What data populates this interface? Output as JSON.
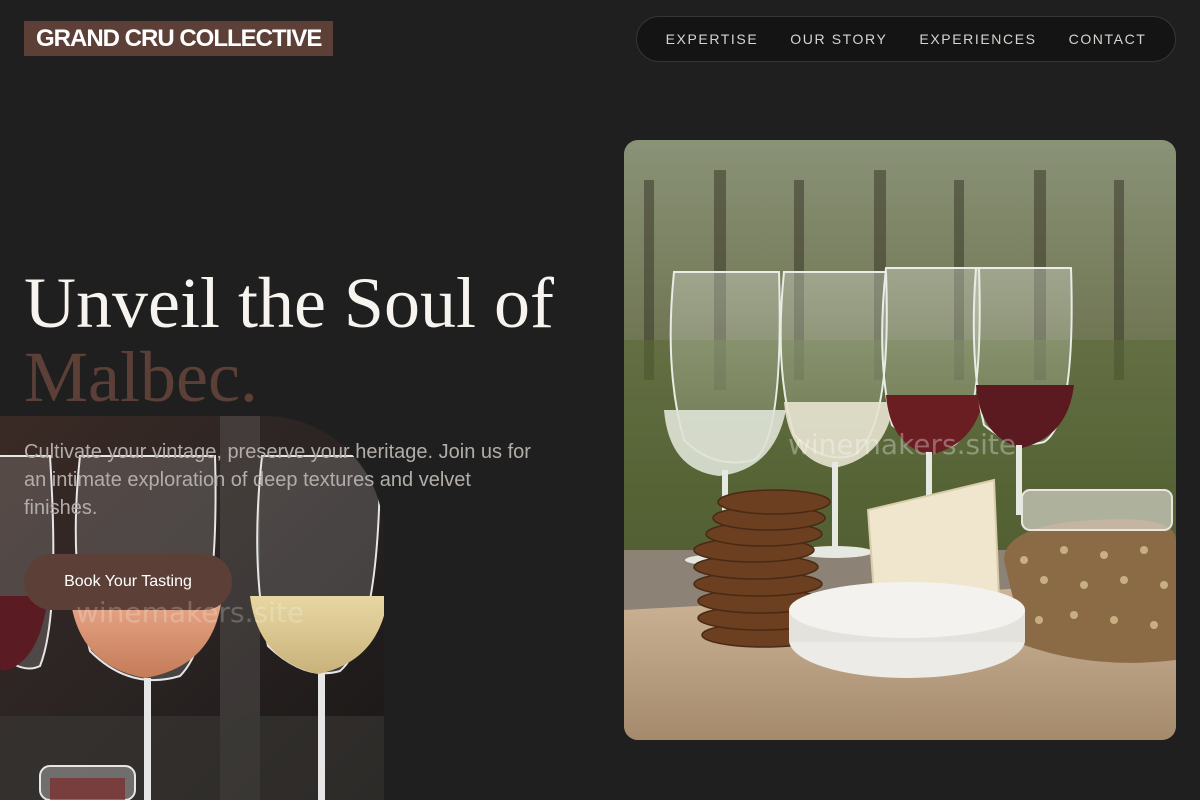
{
  "brand": {
    "logo_text": "GRAND CRU COLLECTIVE"
  },
  "nav": {
    "items": [
      {
        "label": "EXPERTISE"
      },
      {
        "label": "OUR STORY"
      },
      {
        "label": "EXPERIENCES"
      },
      {
        "label": "CONTACT"
      }
    ]
  },
  "hero": {
    "headline_line1": "Unveil the Soul of",
    "headline_accent": "Malbec.",
    "subtext": "Cultivate your vintage, preserve your heritage. Join us for an intimate exploration of deep textures and velvet finishes.",
    "cta_label": "Book Your Tasting",
    "watermark": "winemakers.site"
  },
  "images": {
    "hero_photo": "vineyard wine glasses with cheese and crackers board",
    "side_photo": "glasses of rosé and white wine"
  },
  "colors": {
    "background": "#1f1f1f",
    "accent": "#5c4038",
    "text_primary": "#f7f3ef",
    "text_muted": "#b3ada8",
    "nav_bg": "#141414"
  }
}
